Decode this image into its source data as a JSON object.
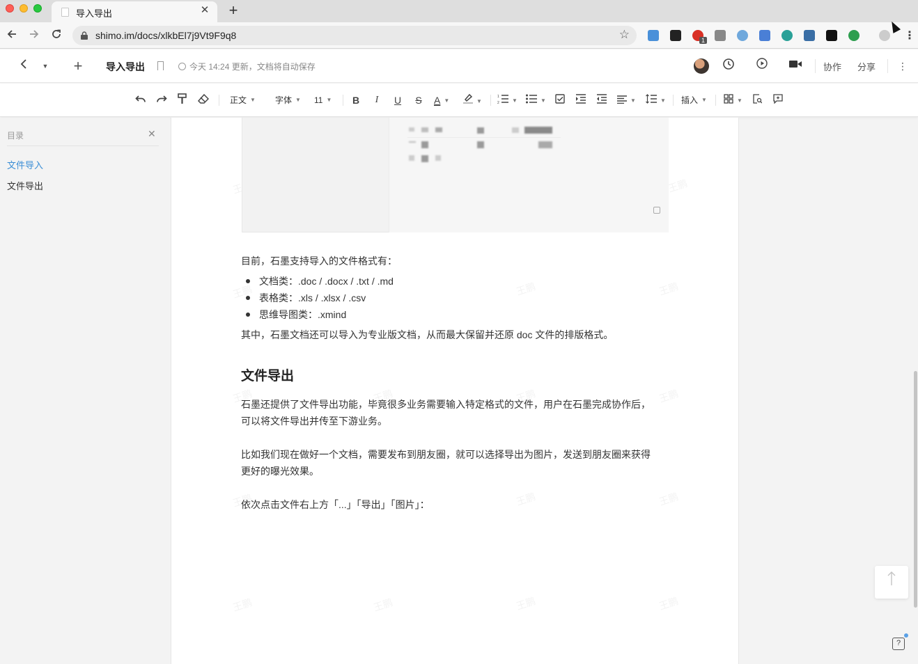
{
  "browser": {
    "tab_title": "导入导出",
    "url": "shimo.im/docs/xlkbEl7j9Vt9F9q8",
    "extension_badge": "1"
  },
  "app_header": {
    "doc_title": "导入导出",
    "save_status": "今天 14:24 更新，文档将自动保存",
    "collaborate_label": "协作",
    "share_label": "分享"
  },
  "toolbar": {
    "paragraph_style": "正文",
    "font_family": "字体",
    "font_size": "11",
    "bold": "B",
    "italic": "I",
    "underline": "U",
    "strikethrough": "S",
    "text_color": "A",
    "insert_label": "插入"
  },
  "toc": {
    "title": "目录",
    "items": [
      {
        "label": "文件导入",
        "active": true
      },
      {
        "label": "文件导出",
        "active": false
      }
    ]
  },
  "document": {
    "intro": "目前，石墨支持导入的文件格式有：",
    "bullets": [
      "文档类：.doc / .docx / .txt / .md",
      "表格类：.xls / .xlsx / .csv",
      "思维导图类：.xmind"
    ],
    "note": "其中，石墨文档还可以导入为专业版文档，从而最大保留并还原 doc 文件的排版格式。",
    "heading_export": "文件导出",
    "para1_line1": "石墨还提供了文件导出功能，毕竟很多业务需要输入特定格式的文件，用户在石墨完成协作后，",
    "para1_line2": "可以将文件导出并传至下游业务。",
    "para2_line1": "比如我们现在做好一个文档，需要发布到朋友圈，就可以选择导出为图片，发送到朋友圈来获得",
    "para2_line2": "更好的曝光效果。",
    "para3": "依次点击文件右上方「...」「导出」「图片」：",
    "watermark": "王鹏"
  },
  "colors": {
    "accent": "#3b8ed6",
    "page_bg": "#ffffff",
    "app_bg": "#f3f3f3"
  }
}
